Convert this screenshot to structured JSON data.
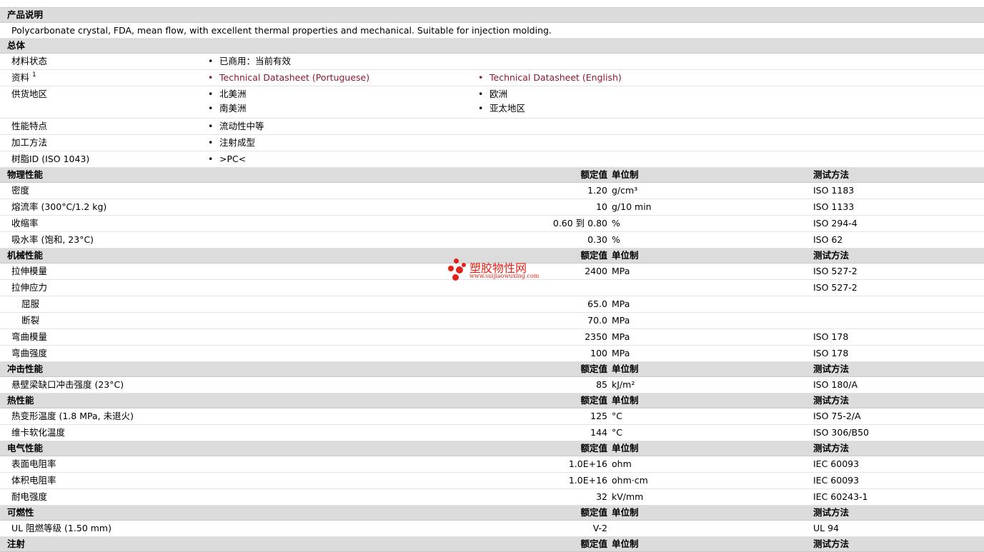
{
  "desc_section": {
    "title": "产品说明",
    "text": "Polycarbonate crystal, FDA, mean flow, with excellent thermal properties and mechanical. Suitable for injection molding."
  },
  "general": {
    "title": "总体",
    "status_label": "材料状态",
    "status_value": "已商用：当前有效",
    "docs_label": "资料",
    "docs_sup": "1",
    "doc1": "Technical Datasheet (Portuguese)",
    "doc2": "Technical Datasheet (English)",
    "region_label": "供货地区",
    "region1": "北美洲",
    "region2": "欧洲",
    "region3": "南美洲",
    "region4": "亚太地区",
    "feature_label": "性能特点",
    "feature_value": "流动性中等",
    "process_label": "加工方法",
    "process_value": "注射成型",
    "resin_label": "树脂ID (ISO 1043)",
    "resin_value": ">PC<"
  },
  "headers": {
    "value": "额定值",
    "unit": "单位制",
    "method": "测试方法"
  },
  "sections": [
    {
      "title": "物理性能",
      "rows": [
        {
          "label": "密度",
          "value": "1.20",
          "unit": "g/cm³",
          "method": "ISO 1183"
        },
        {
          "label": "熔流率 (300°C/1.2 kg)",
          "value": "10",
          "unit": "g/10 min",
          "method": "ISO 1133"
        },
        {
          "label": "收缩率",
          "value": "0.60 到  0.80",
          "unit": "%",
          "method": "ISO 294-4"
        },
        {
          "label": "吸水率 (饱和, 23°C)",
          "value": "0.30",
          "unit": "%",
          "method": "ISO 62"
        }
      ]
    },
    {
      "title": "机械性能",
      "rows": [
        {
          "label": "拉伸模量",
          "value": "2400",
          "unit": "MPa",
          "method": "ISO 527-2"
        },
        {
          "label": "拉伸应力",
          "value": "",
          "unit": "",
          "method": "ISO 527-2"
        },
        {
          "label": "屈服",
          "value": "65.0",
          "unit": "MPa",
          "method": "",
          "indent": true
        },
        {
          "label": "断裂",
          "value": "70.0",
          "unit": "MPa",
          "method": "",
          "indent": true
        },
        {
          "label": "弯曲模量",
          "value": "2350",
          "unit": "MPa",
          "method": "ISO 178"
        },
        {
          "label": "弯曲强度",
          "value": "100",
          "unit": "MPa",
          "method": "ISO 178"
        }
      ]
    },
    {
      "title": "冲击性能",
      "rows": [
        {
          "label": "悬壁梁缺口冲击强度 (23°C)",
          "value": "85",
          "unit": "kJ/m²",
          "method": "ISO 180/A"
        }
      ]
    },
    {
      "title": "热性能",
      "rows": [
        {
          "label": "热变形温度 (1.8 MPa, 未退火)",
          "value": "125",
          "unit": "°C",
          "method": "ISO 75-2/A"
        },
        {
          "label": "维卡软化温度",
          "value": "144",
          "unit": "°C",
          "method": "ISO 306/B50"
        }
      ]
    },
    {
      "title": "电气性能",
      "rows": [
        {
          "label": "表面电阻率",
          "value": "1.0E+16",
          "unit": "ohm",
          "method": "IEC 60093"
        },
        {
          "label": "体积电阻率",
          "value": "1.0E+16",
          "unit": "ohm·cm",
          "method": "IEC 60093"
        },
        {
          "label": "耐电强度",
          "value": "32",
          "unit": "kV/mm",
          "method": "IEC 60243-1"
        }
      ]
    },
    {
      "title": "可燃性",
      "rows": [
        {
          "label": "UL 阻燃等级 (1.50 mm)",
          "value": "V-2",
          "unit": "",
          "method": "UL 94"
        }
      ]
    },
    {
      "title": "注射",
      "rows": []
    }
  ],
  "watermark": {
    "text": "塑胶物性网",
    "url": "www.suijiaowuxing.com"
  },
  "colors": {
    "section_bg": "#dcdcdc",
    "link": "#8b1a2b",
    "watermark": "#e2231a"
  }
}
